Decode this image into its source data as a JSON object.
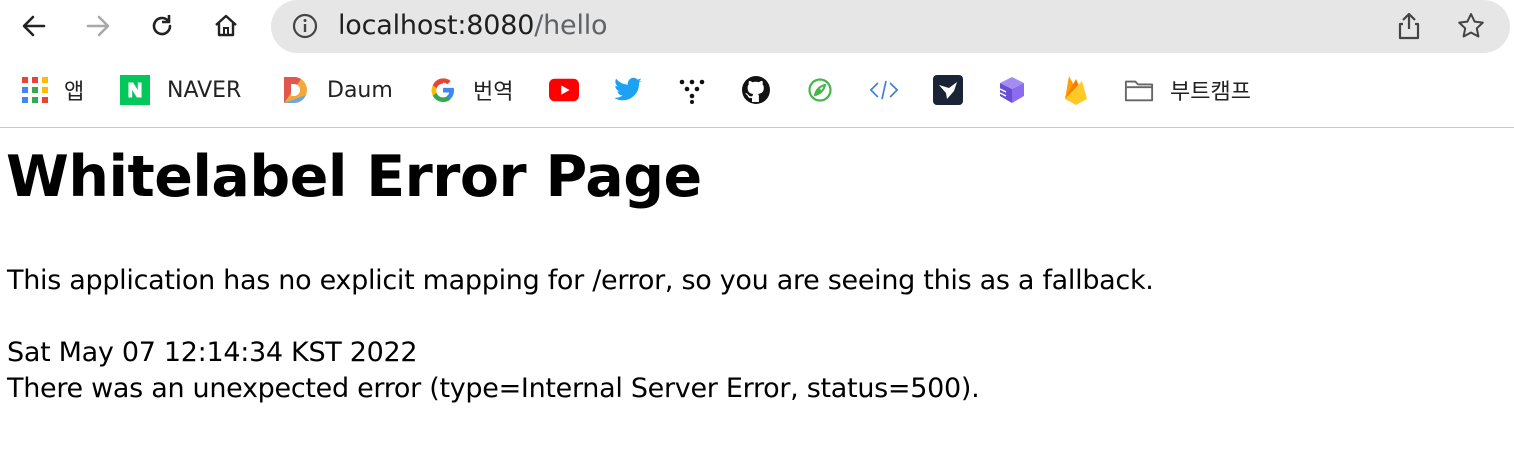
{
  "browser": {
    "url_host": "localhost:8080",
    "url_path": "/hello",
    "bookmarks": [
      {
        "label": "앱",
        "icon": "apps-grid-icon"
      },
      {
        "label": "NAVER",
        "icon": "naver-icon"
      },
      {
        "label": "Daum",
        "icon": "daum-icon"
      },
      {
        "label": "번역",
        "icon": "google-icon"
      },
      {
        "label": "",
        "icon": "youtube-icon"
      },
      {
        "label": "",
        "icon": "twitter-icon"
      },
      {
        "label": "",
        "icon": "dots-icon"
      },
      {
        "label": "",
        "icon": "github-icon"
      },
      {
        "label": "",
        "icon": "leaf-icon"
      },
      {
        "label": "",
        "icon": "code-icon"
      },
      {
        "label": "",
        "icon": "bird-icon"
      },
      {
        "label": "",
        "icon": "cube-icon"
      },
      {
        "label": "",
        "icon": "firebase-icon"
      },
      {
        "label": "부트캠프",
        "icon": "folder-icon"
      }
    ],
    "colors": {
      "accent_google_blue": "#4285f4",
      "youtube_red": "#ff0000",
      "naver_green": "#03c75a",
      "twitter_blue": "#1da1f2"
    }
  },
  "page": {
    "title": "Whitelabel Error Page",
    "message": "This application has no explicit mapping for /error, so you are seeing this as a fallback.",
    "timestamp": "Sat May 07 12:14:34 KST 2022",
    "error_detail": "There was an unexpected error (type=Internal Server Error, status=500)."
  }
}
